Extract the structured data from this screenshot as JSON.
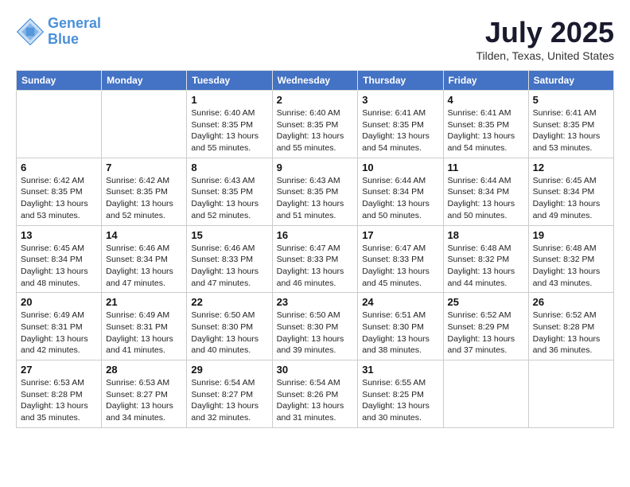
{
  "header": {
    "logo_line1": "General",
    "logo_line2": "Blue",
    "month_title": "July 2025",
    "location": "Tilden, Texas, United States"
  },
  "weekdays": [
    "Sunday",
    "Monday",
    "Tuesday",
    "Wednesday",
    "Thursday",
    "Friday",
    "Saturday"
  ],
  "weeks": [
    [
      {
        "day": "",
        "info": ""
      },
      {
        "day": "",
        "info": ""
      },
      {
        "day": "1",
        "info": "Sunrise: 6:40 AM\nSunset: 8:35 PM\nDaylight: 13 hours\nand 55 minutes."
      },
      {
        "day": "2",
        "info": "Sunrise: 6:40 AM\nSunset: 8:35 PM\nDaylight: 13 hours\nand 55 minutes."
      },
      {
        "day": "3",
        "info": "Sunrise: 6:41 AM\nSunset: 8:35 PM\nDaylight: 13 hours\nand 54 minutes."
      },
      {
        "day": "4",
        "info": "Sunrise: 6:41 AM\nSunset: 8:35 PM\nDaylight: 13 hours\nand 54 minutes."
      },
      {
        "day": "5",
        "info": "Sunrise: 6:41 AM\nSunset: 8:35 PM\nDaylight: 13 hours\nand 53 minutes."
      }
    ],
    [
      {
        "day": "6",
        "info": "Sunrise: 6:42 AM\nSunset: 8:35 PM\nDaylight: 13 hours\nand 53 minutes."
      },
      {
        "day": "7",
        "info": "Sunrise: 6:42 AM\nSunset: 8:35 PM\nDaylight: 13 hours\nand 52 minutes."
      },
      {
        "day": "8",
        "info": "Sunrise: 6:43 AM\nSunset: 8:35 PM\nDaylight: 13 hours\nand 52 minutes."
      },
      {
        "day": "9",
        "info": "Sunrise: 6:43 AM\nSunset: 8:35 PM\nDaylight: 13 hours\nand 51 minutes."
      },
      {
        "day": "10",
        "info": "Sunrise: 6:44 AM\nSunset: 8:34 PM\nDaylight: 13 hours\nand 50 minutes."
      },
      {
        "day": "11",
        "info": "Sunrise: 6:44 AM\nSunset: 8:34 PM\nDaylight: 13 hours\nand 50 minutes."
      },
      {
        "day": "12",
        "info": "Sunrise: 6:45 AM\nSunset: 8:34 PM\nDaylight: 13 hours\nand 49 minutes."
      }
    ],
    [
      {
        "day": "13",
        "info": "Sunrise: 6:45 AM\nSunset: 8:34 PM\nDaylight: 13 hours\nand 48 minutes."
      },
      {
        "day": "14",
        "info": "Sunrise: 6:46 AM\nSunset: 8:34 PM\nDaylight: 13 hours\nand 47 minutes."
      },
      {
        "day": "15",
        "info": "Sunrise: 6:46 AM\nSunset: 8:33 PM\nDaylight: 13 hours\nand 47 minutes."
      },
      {
        "day": "16",
        "info": "Sunrise: 6:47 AM\nSunset: 8:33 PM\nDaylight: 13 hours\nand 46 minutes."
      },
      {
        "day": "17",
        "info": "Sunrise: 6:47 AM\nSunset: 8:33 PM\nDaylight: 13 hours\nand 45 minutes."
      },
      {
        "day": "18",
        "info": "Sunrise: 6:48 AM\nSunset: 8:32 PM\nDaylight: 13 hours\nand 44 minutes."
      },
      {
        "day": "19",
        "info": "Sunrise: 6:48 AM\nSunset: 8:32 PM\nDaylight: 13 hours\nand 43 minutes."
      }
    ],
    [
      {
        "day": "20",
        "info": "Sunrise: 6:49 AM\nSunset: 8:31 PM\nDaylight: 13 hours\nand 42 minutes."
      },
      {
        "day": "21",
        "info": "Sunrise: 6:49 AM\nSunset: 8:31 PM\nDaylight: 13 hours\nand 41 minutes."
      },
      {
        "day": "22",
        "info": "Sunrise: 6:50 AM\nSunset: 8:30 PM\nDaylight: 13 hours\nand 40 minutes."
      },
      {
        "day": "23",
        "info": "Sunrise: 6:50 AM\nSunset: 8:30 PM\nDaylight: 13 hours\nand 39 minutes."
      },
      {
        "day": "24",
        "info": "Sunrise: 6:51 AM\nSunset: 8:30 PM\nDaylight: 13 hours\nand 38 minutes."
      },
      {
        "day": "25",
        "info": "Sunrise: 6:52 AM\nSunset: 8:29 PM\nDaylight: 13 hours\nand 37 minutes."
      },
      {
        "day": "26",
        "info": "Sunrise: 6:52 AM\nSunset: 8:28 PM\nDaylight: 13 hours\nand 36 minutes."
      }
    ],
    [
      {
        "day": "27",
        "info": "Sunrise: 6:53 AM\nSunset: 8:28 PM\nDaylight: 13 hours\nand 35 minutes."
      },
      {
        "day": "28",
        "info": "Sunrise: 6:53 AM\nSunset: 8:27 PM\nDaylight: 13 hours\nand 34 minutes."
      },
      {
        "day": "29",
        "info": "Sunrise: 6:54 AM\nSunset: 8:27 PM\nDaylight: 13 hours\nand 32 minutes."
      },
      {
        "day": "30",
        "info": "Sunrise: 6:54 AM\nSunset: 8:26 PM\nDaylight: 13 hours\nand 31 minutes."
      },
      {
        "day": "31",
        "info": "Sunrise: 6:55 AM\nSunset: 8:25 PM\nDaylight: 13 hours\nand 30 minutes."
      },
      {
        "day": "",
        "info": ""
      },
      {
        "day": "",
        "info": ""
      }
    ]
  ]
}
